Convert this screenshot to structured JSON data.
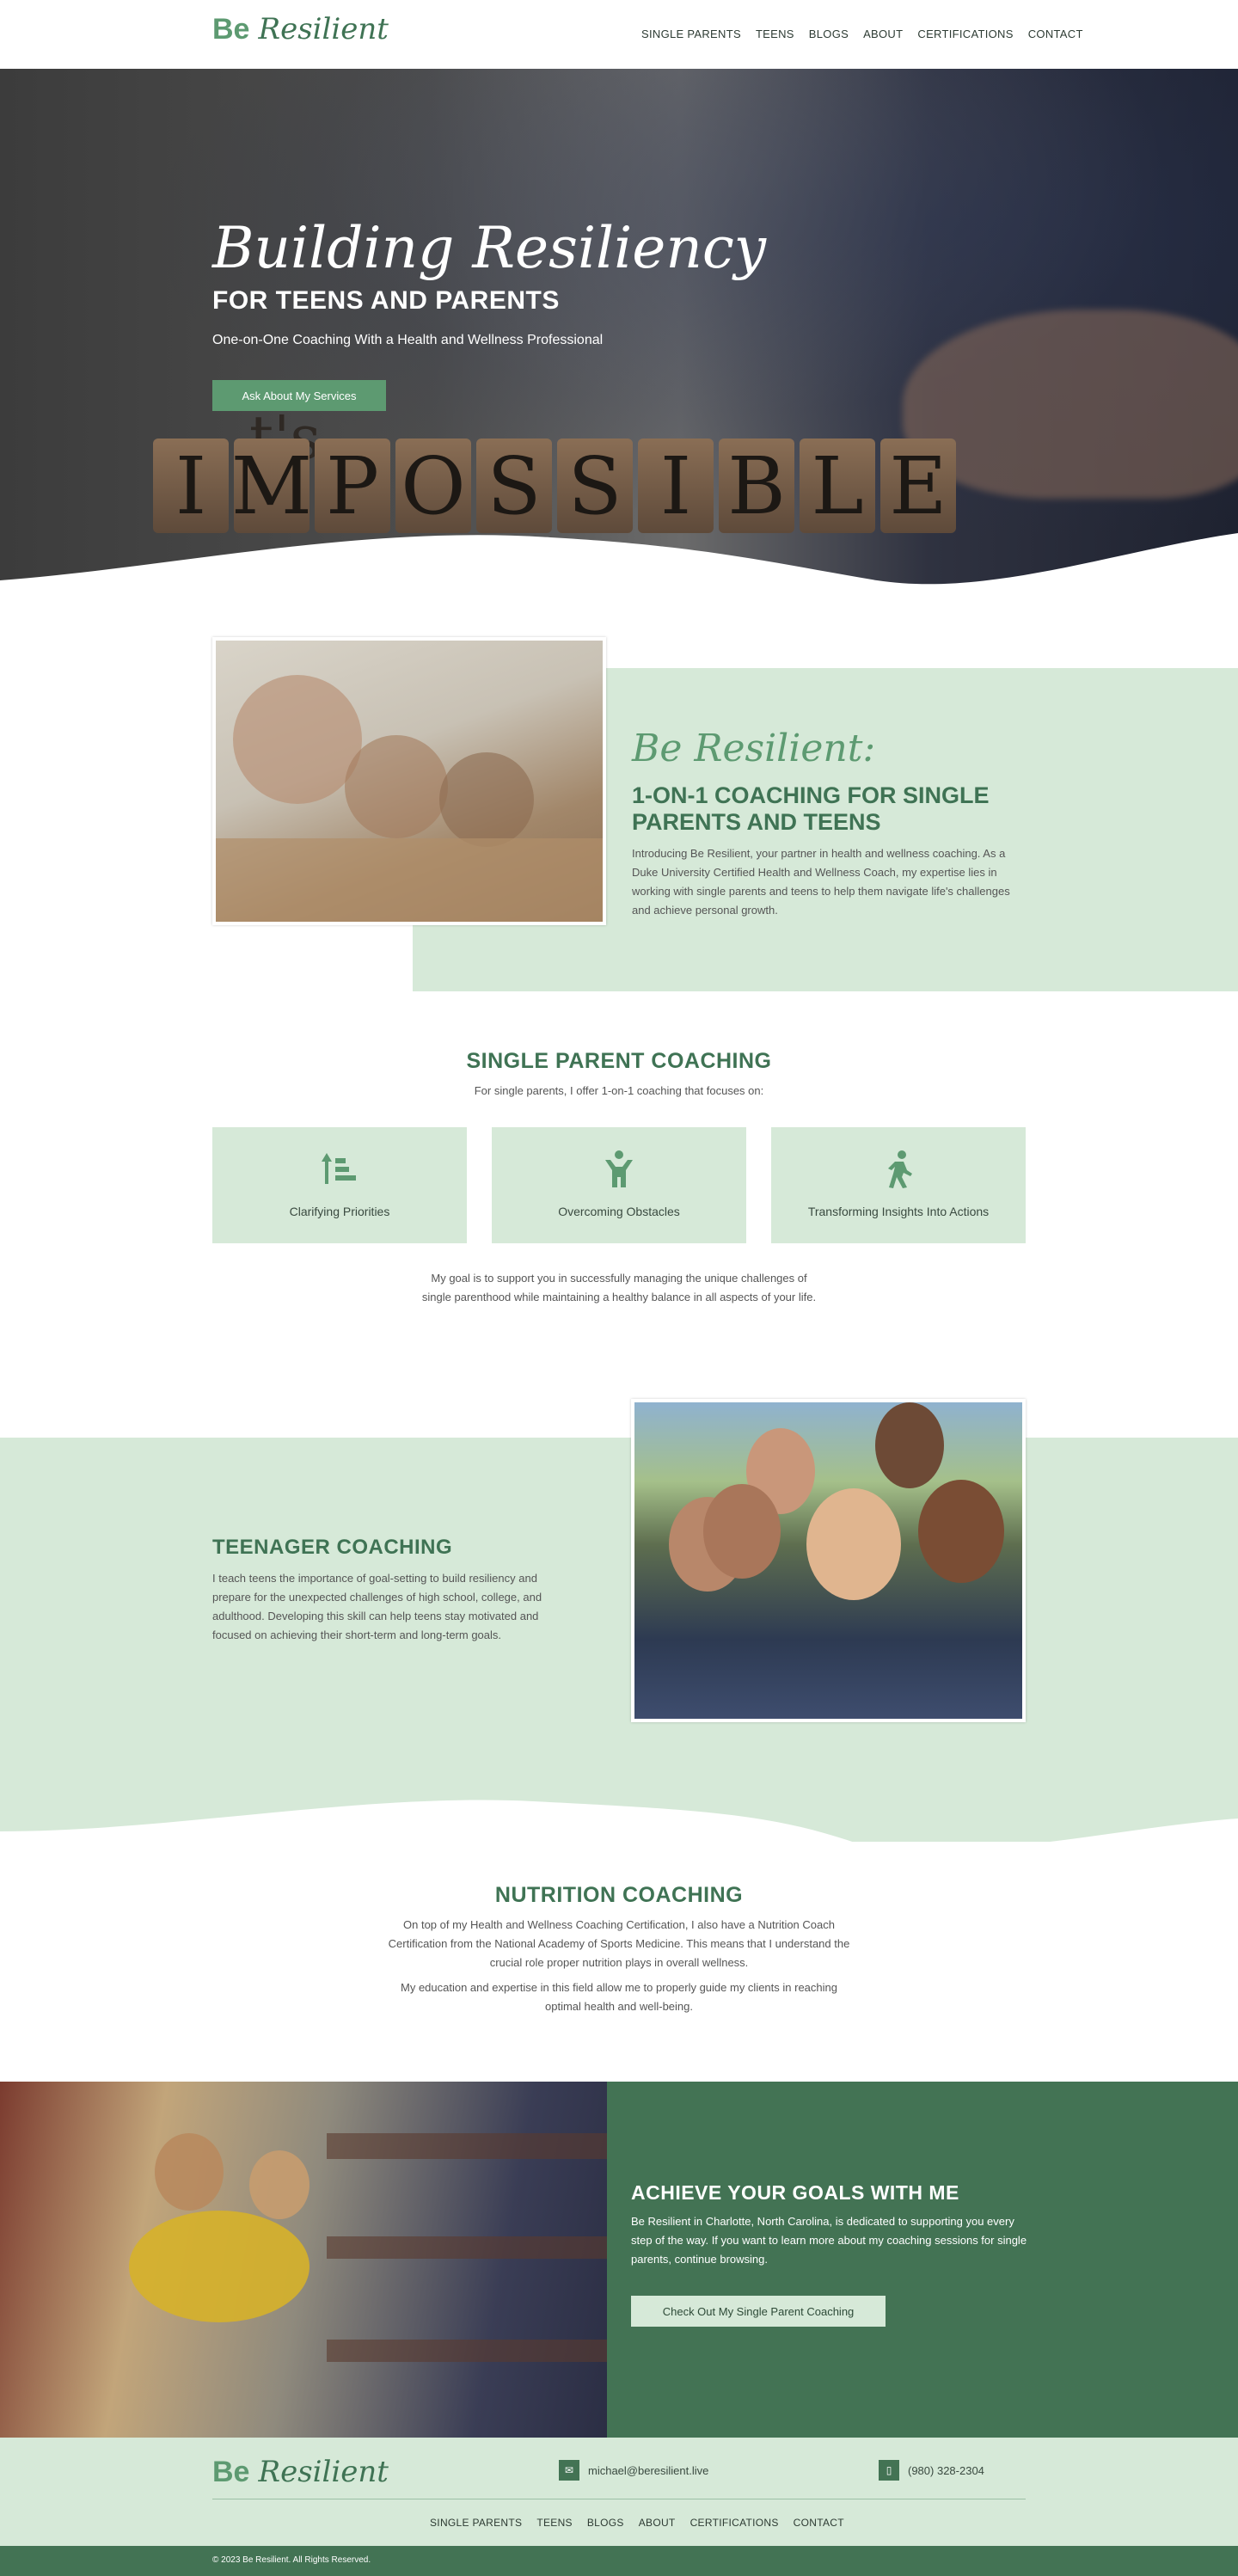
{
  "header": {
    "logo_be": "Be",
    "logo_resilient": "Resilient",
    "nav": [
      "SINGLE PARENTS",
      "TEENS",
      "BLOGS",
      "ABOUT",
      "CERTIFICATIONS",
      "CONTACT"
    ]
  },
  "hero": {
    "title_script": "Building Resiliency",
    "title": "FOR TEENS AND PARENTS",
    "subtitle": "One-on-One Coaching With a Health and Wellness Professional",
    "cta": "Ask About My Services"
  },
  "intro": {
    "script": "Be Resilient:",
    "heading": "1-ON-1 COACHING FOR SINGLE PARENTS AND TEENS",
    "body": "Introducing Be Resilient, your partner in health and wellness coaching. As a Duke University Certified Health and Wellness Coach, my expertise lies in working with single parents and teens to help them navigate life's challenges and achieve personal growth."
  },
  "single_parent": {
    "heading": "SINGLE PARENT COACHING",
    "intro": "For single parents, I offer 1-on-1 coaching that focuses on:",
    "cards": [
      {
        "icon": "priorities-icon",
        "label": "Clarifying Priorities"
      },
      {
        "icon": "person-icon",
        "label": "Overcoming Obstacles"
      },
      {
        "icon": "walking-icon",
        "label": "Transforming Insights Into Actions"
      }
    ],
    "goal": "My goal is to support you in successfully managing the unique challenges of single parenthood while maintaining a healthy balance in all aspects of your life."
  },
  "teen": {
    "heading": "TEENAGER COACHING",
    "body": "I teach teens the importance of goal-setting to build resiliency and prepare for the unexpected challenges of high school, college, and adulthood. Developing this skill can help teens stay motivated and focused on achieving their short-term and long-term goals."
  },
  "nutrition": {
    "heading": "NUTRITION COACHING",
    "p1": "On top of my Health and Wellness Coaching Certification, I also have a Nutrition Coach Certification from the National Academy of Sports Medicine. This means that I understand the crucial role proper nutrition plays in overall wellness.",
    "p2": "My education and expertise in this field allow me to properly guide my clients in reaching optimal health and well-being."
  },
  "achieve": {
    "heading": "ACHIEVE YOUR GOALS WITH ME",
    "body": "Be Resilient in Charlotte, North Carolina, is dedicated to supporting you every step of the way. If you want to learn more about my coaching sessions for single parents, continue browsing.",
    "cta": "Check Out My Single Parent Coaching"
  },
  "footer": {
    "email": "michael@beresilient.live",
    "phone": "(980) 328-2304",
    "nav": [
      "SINGLE PARENTS",
      "TEENS",
      "BLOGS",
      "ABOUT",
      "CERTIFICATIONS",
      "CONTACT"
    ],
    "copyright": "© 2023 Be Resilient. All Rights Reserved."
  },
  "colors": {
    "brand_green": "#5d9a71",
    "dark_green": "#437354",
    "light_green": "#d6e9d8"
  }
}
